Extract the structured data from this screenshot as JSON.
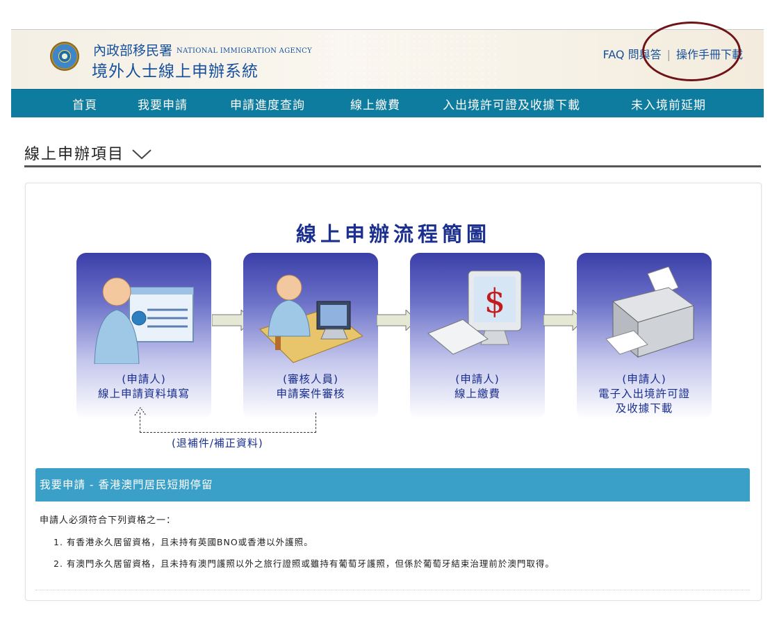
{
  "header": {
    "agency_zh": "內政部移民署",
    "agency_en": "NATIONAL IMMIGRATION AGENCY",
    "system_name": "境外人士線上申辦系統",
    "faq_link": "FAQ 問與答",
    "manual_link": "操作手冊下載",
    "link_separator": "|"
  },
  "nav": {
    "items": [
      {
        "label": "首頁"
      },
      {
        "label": "我要申請"
      },
      {
        "label": "申請進度查詢"
      },
      {
        "label": "線上繳費"
      },
      {
        "label": "入出境許可證及收據下載"
      },
      {
        "label": "未入境前延期"
      }
    ]
  },
  "section": {
    "title": "線上申辦項目"
  },
  "flow": {
    "title": "線上申辦流程簡圖",
    "steps": [
      {
        "role": "(申請人)",
        "desc": "線上申請資料填寫",
        "desc2": ""
      },
      {
        "role": "(審核人員)",
        "desc": "申請案件審核",
        "desc2": ""
      },
      {
        "role": "(申請人)",
        "desc": "線上繳費",
        "desc2": ""
      },
      {
        "role": "(申請人)",
        "desc": "電子入出境許可證",
        "desc2": "及收據下載"
      }
    ],
    "return_label": "(退補件/補正資料)"
  },
  "apply": {
    "bar_title": "我要申請 - 香港澳門居民短期停留",
    "intro": "申請人必須符合下列資格之一：",
    "requirements": [
      "1. 有香港永久居留資格，且未持有英國BNO或香港以外護照。",
      "2. 有澳門永久居留資格，且未持有澳門護照以外之旅行證照或雖持有葡萄牙護照，但係於葡萄牙結束治理前於澳門取得。"
    ]
  },
  "colors": {
    "nav_bg": "#0e7c9f",
    "brand_blue": "#16509b",
    "flow_title": "#1b2f8f",
    "apply_bar": "#3aa0c8",
    "highlight_oval": "#6e1418"
  }
}
